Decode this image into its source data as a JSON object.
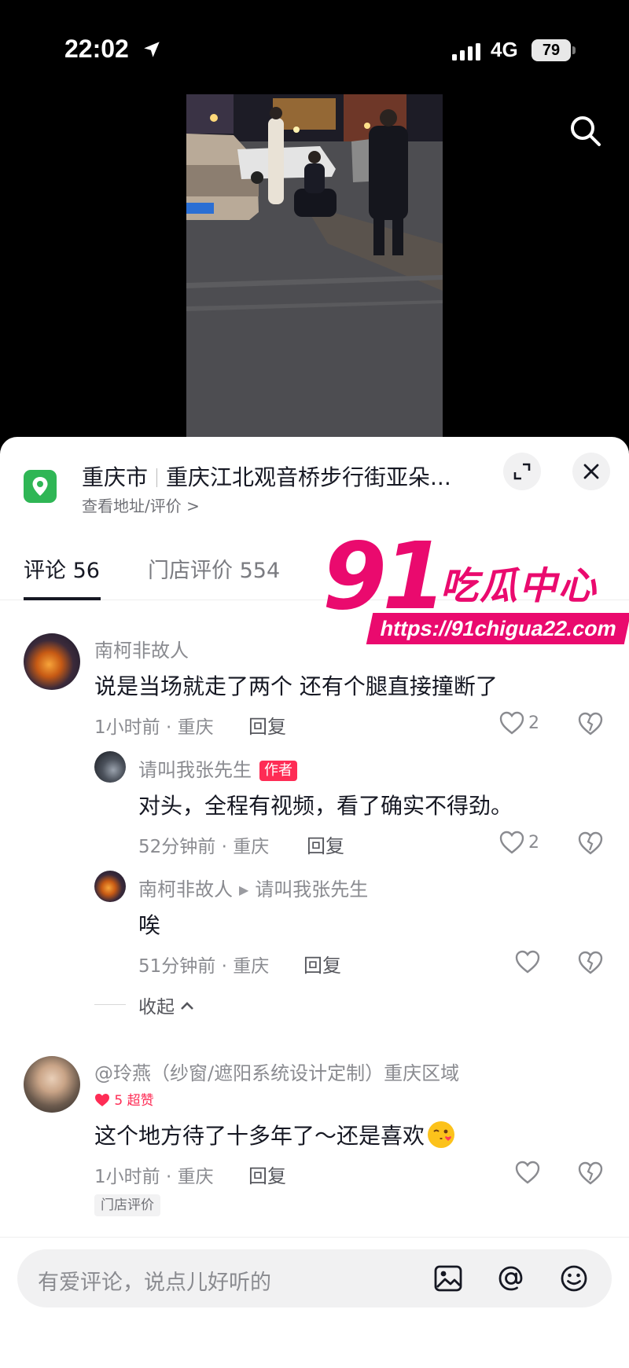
{
  "status_bar": {
    "time": "22:02",
    "network": "4G",
    "battery": "79"
  },
  "video": {
    "search_icon": "search-icon"
  },
  "location": {
    "city": "重庆市",
    "place": "重庆江北观音桥步行街亚朵...",
    "sub_link": "查看地址/评价 >",
    "pin_color": "#2fb655"
  },
  "tabs": [
    {
      "label": "评论 56",
      "active": true
    },
    {
      "label": "门店评价 554",
      "active": false
    }
  ],
  "watermark": {
    "number": "91",
    "text": "吃瓜中心",
    "url": "https://91chigua22.com",
    "color": "#ea0a6e"
  },
  "comments": [
    {
      "user": "南柯非故人",
      "text": "说是当场就走了两个 还有个腿直接撞断了",
      "meta": "1小时前 · 重庆",
      "reply_label": "回复",
      "likes": "2",
      "replies": [
        {
          "user": "请叫我张先生",
          "badge": "作者",
          "text": "对头，全程有视频，看了确实不得劲。",
          "meta": "52分钟前 · 重庆",
          "reply_label": "回复",
          "likes": "2"
        },
        {
          "user": "南柯非故人",
          "reply_to": "请叫我张先生",
          "text": "唉",
          "meta": "51分钟前 · 重庆",
          "reply_label": "回复",
          "likes": ""
        }
      ],
      "collapse_label": "收起"
    },
    {
      "user": "@玲燕（纱窗/遮阳系统设计定制）重庆区域",
      "super_like": "5 超赞",
      "text": "这个地方待了十多年了～还是喜欢",
      "meta": "1小时前 · 重庆",
      "reply_label": "回复",
      "likes": "",
      "tag": "门店评价"
    }
  ],
  "input_bar": {
    "placeholder": "有爱评论，说点儿好听的"
  },
  "accent_color": "#fe2c55"
}
